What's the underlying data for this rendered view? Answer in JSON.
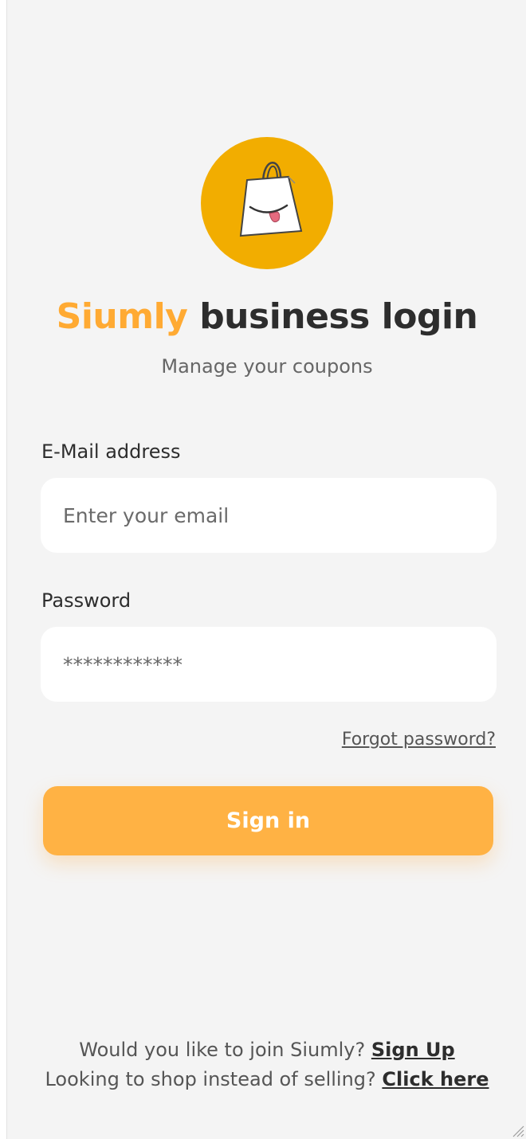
{
  "header": {
    "title_brand": "Siumly",
    "title_rest": "business login",
    "subtitle": "Manage your coupons"
  },
  "form": {
    "email_label": "E-Mail address",
    "email_placeholder": "Enter your email",
    "password_label": "Password",
    "password_value": "************",
    "forgot_link": "Forgot password?",
    "signin_label": "Sign in"
  },
  "footer": {
    "join_text": "Would you like to join Siumly?",
    "signup_link": "Sign Up",
    "shop_text": "Looking to shop instead of selling?",
    "click_link": "Click here"
  },
  "colors": {
    "brand_orange": "#ffaa33",
    "logo_yellow": "#f2ad00",
    "button_orange": "#ffb244",
    "background": "#f4f4f4"
  },
  "icons": {
    "logo": "shopping-bag-smile-icon",
    "resize": "resize-grip-icon"
  }
}
